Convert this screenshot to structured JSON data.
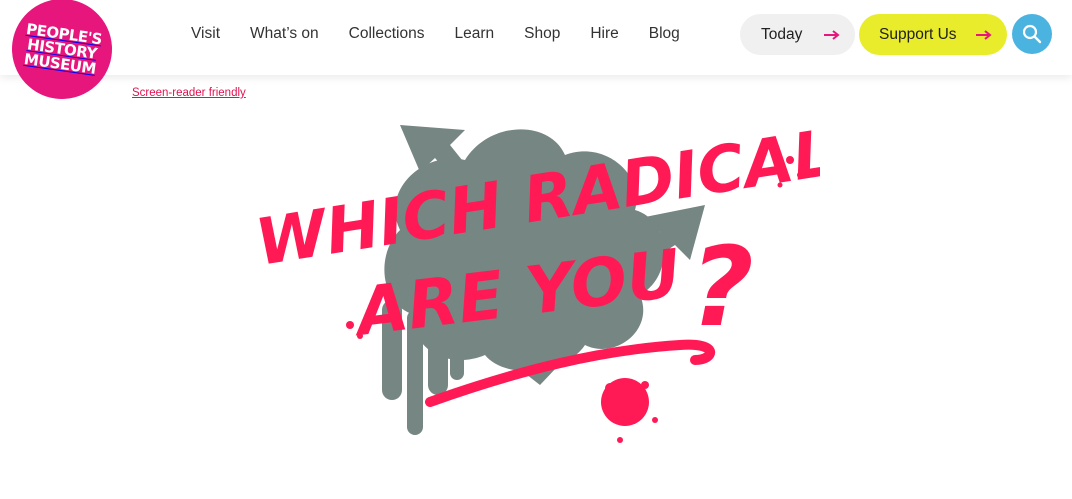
{
  "logo": {
    "lines": [
      "PEOPLE'S",
      "HISTORY",
      "MUSEUM"
    ],
    "color": "#e6167d"
  },
  "nav": {
    "items": [
      "Visit",
      "What’s on",
      "Collections",
      "Learn",
      "Shop",
      "Hire",
      "Blog"
    ]
  },
  "actions": {
    "today_label": "Today",
    "support_label": "Support Us",
    "arrow_color": "#e6167d",
    "support_color": "#e8ec2b",
    "search_color": "#4ab3e0"
  },
  "accessibility": {
    "screen_reader_label": "Screen-reader friendly"
  },
  "hero": {
    "lines": [
      "WHICH RADICAL",
      "ARE YOU"
    ],
    "mark": "?",
    "text_color": "#ff1a55",
    "symbol_color": "#768683"
  }
}
